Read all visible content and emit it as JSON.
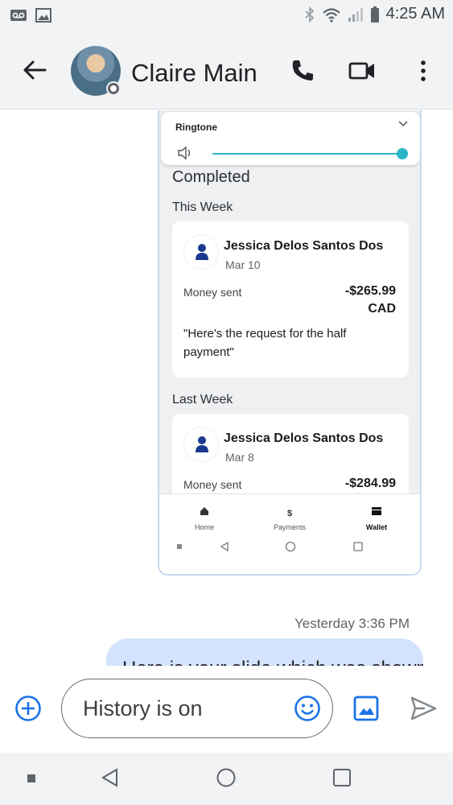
{
  "status_bar": {
    "time": "4:25 AM"
  },
  "header": {
    "contact_name": "Claire Main"
  },
  "screenshot": {
    "ringtone_title": "Ringtone",
    "completed_heading": "Completed",
    "sections": [
      {
        "label": "This Week",
        "transaction": {
          "name": "Jessica Delos Santos Dos",
          "date": "Mar 10",
          "type": "Money sent",
          "amount": "-$265.99",
          "currency": "CAD",
          "note": "\"Here's the request for the half payment\""
        }
      },
      {
        "label": "Last Week",
        "transaction": {
          "name": "Jessica Delos Santos Dos",
          "date": "Mar 8",
          "type": "Money sent",
          "amount": "-$284.99"
        }
      }
    ],
    "nav": {
      "home": "Home",
      "payments": "Payments",
      "wallet": "Wallet",
      "payments_symbol": "$"
    }
  },
  "message": {
    "timestamp": "Yesterday 3:36 PM",
    "text": "Here is your slide which was shown"
  },
  "compose": {
    "placeholder": "History is on"
  },
  "colors": {
    "accent": "#1a73e8",
    "bubble": "#d3e3fd",
    "slider": "#2bb5c8",
    "header_bg": "#f1f3f4"
  },
  "icons": [
    "voicemail-icon",
    "image-icon",
    "bluetooth-icon",
    "wifi-icon",
    "signal-icon",
    "battery-icon",
    "back-arrow-icon",
    "phone-icon",
    "video-icon",
    "more-vert-icon",
    "add-circle-icon",
    "emoji-icon",
    "gallery-icon",
    "send-icon"
  ]
}
